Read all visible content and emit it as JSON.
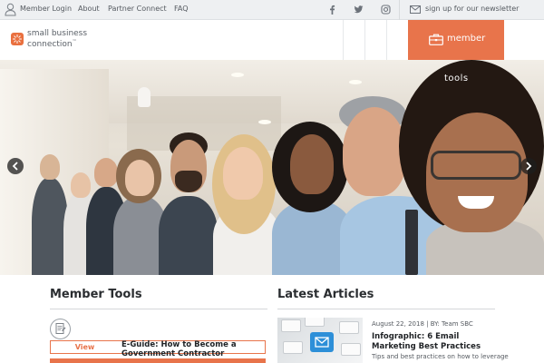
{
  "topbar": {
    "member_login": "Member Login",
    "about": "About",
    "partner_connect": "Partner Connect",
    "faq": "FAQ",
    "newsletter": "sign up for our newsletter",
    "social_icons": [
      "facebook-icon",
      "twitter-icon",
      "instagram-icon"
    ]
  },
  "header": {
    "logo_line1": "small business",
    "logo_line2": "connection",
    "logo_mark": "™",
    "member_label": "member"
  },
  "hero": {
    "overlay_text": "tools",
    "prev_icon": "chevron-left-icon",
    "next_icon": "chevron-right-icon"
  },
  "member_tools": {
    "title": "Member Tools",
    "items": [
      {
        "view_label": "View",
        "title": "E-Guide: How to Become a Government Contractor"
      }
    ]
  },
  "latest_articles": {
    "title": "Latest Articles",
    "items": [
      {
        "meta": "August 22, 2018 | BY: Team SBC",
        "title": "Infographic: 6 Email Marketing Best Practices",
        "description": "Tips and best practices on how to leverage"
      }
    ]
  },
  "colors": {
    "accent": "#e8744b",
    "topbar_bg": "#eef0f2",
    "text_dark": "#2a2d30"
  }
}
